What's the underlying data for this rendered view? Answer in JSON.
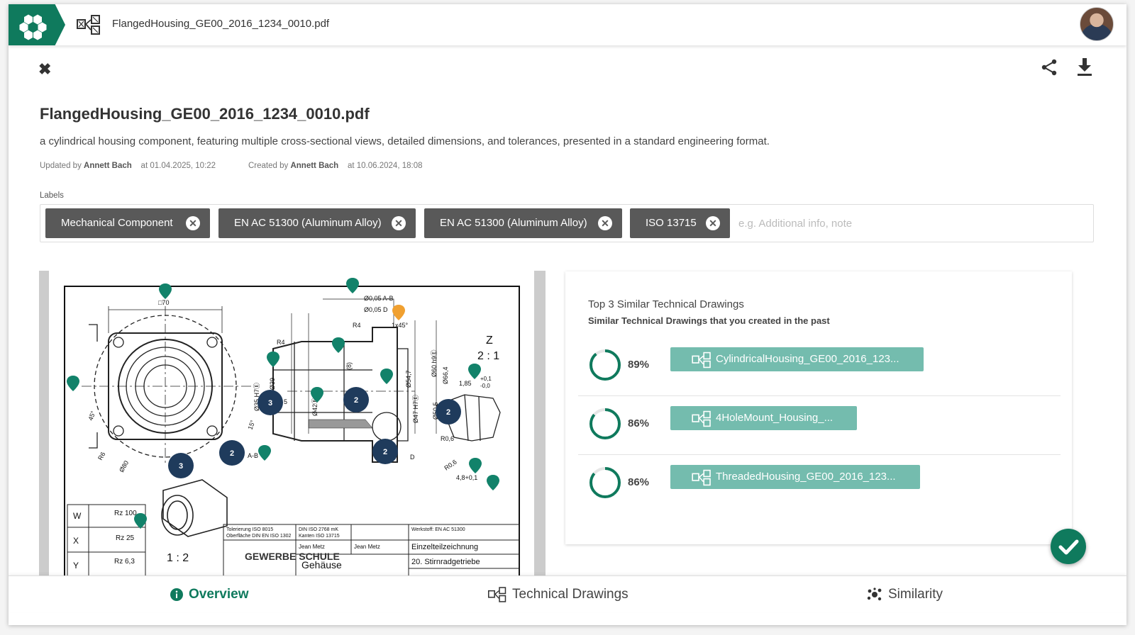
{
  "topbar": {
    "filename": "FlangedHousing_GE00_2016_1234_0010.pdf"
  },
  "document": {
    "title": "FlangedHousing_GE00_2016_1234_0010.pdf",
    "description": "a cylindrical housing component, featuring multiple cross-sectional views, detailed dimensions, and tolerances, presented in a standard engineering format.",
    "updated": {
      "label": "Updated by",
      "user": "Annett Bach",
      "at": "at 01.04.2025, 10:22"
    },
    "created": {
      "label": "Created by",
      "user": "Annett Bach",
      "at": "at 10.06.2024, 18:08"
    }
  },
  "labels": {
    "caption": "Labels",
    "chips": [
      "Mechanical Component",
      "EN AC 51300 (Aluminum Alloy)",
      "EN AC 51300 (Aluminum Alloy)",
      "ISO 13715"
    ],
    "placeholder": "e.g. Additional info, note"
  },
  "similar": {
    "title": "Top 3 Similar Technical Drawings",
    "subtitle": "Similar Technical Drawings that you created in the past",
    "items": [
      {
        "percent": "89%",
        "value": 0.89,
        "name": "CylindricalHousing_GE00_2016_123..."
      },
      {
        "percent": "86%",
        "value": 0.86,
        "name": "4HoleMount_Housing_..."
      },
      {
        "percent": "86%",
        "value": 0.86,
        "name": "ThreadedHousing_GE00_2016_123..."
      }
    ]
  },
  "drawing": {
    "scale_main": "1 : 2",
    "detail_label": "Z",
    "detail_scale": "2 : 1",
    "title_block": {
      "school": "GEWERBE SCHULE",
      "part_name": "Gehäuse",
      "drawing_type": "Einzelteilzeichnung",
      "assembly": "20. Stirnradgetriebe",
      "material": "Werkstoff: EN AC 51300",
      "tolerance": "Tolerierung ISO 8015",
      "surface": "Oberfläche DIN EN ISO 1302",
      "norm1": "DIN ISO 2768 mK",
      "norm2": "Kanten ISO 13715",
      "author": "Jean Metz",
      "checker": "Jean Metz"
    },
    "roughness": [
      "Rz 100",
      "Rz 25",
      "Rz 6,3"
    ],
    "roughness_keys": [
      "W",
      "X",
      "Y"
    ],
    "markers": [
      "3",
      "2",
      "2",
      "2",
      "3",
      "2"
    ],
    "dims": [
      "□70",
      "Ø0,05 A-B",
      "Ø0,05 D",
      "1x45°",
      "R4",
      "R4",
      "Ø35 H7Ⓔ",
      "Ø39",
      "Ø42Ⓔ",
      "Ø54,7",
      "Ø47 H7Ⓔ",
      "Ø60 h9Ⓔ",
      "Ø66,4",
      "Ø50,5",
      "1,85",
      "+0,1",
      "-0,0",
      "R0,6",
      "R0,6",
      "4,8+0,1",
      "Ø80",
      "R6",
      "45°",
      "15°",
      "A-B",
      "D",
      "(8)",
      "5"
    ]
  },
  "nav": {
    "overview": "Overview",
    "drawings": "Technical Drawings",
    "similarity": "Similarity"
  },
  "colors": {
    "brand": "#0f7a5d",
    "chip": "#595959",
    "similar_button": "#74bcae",
    "marker": "#1f3b5c"
  }
}
